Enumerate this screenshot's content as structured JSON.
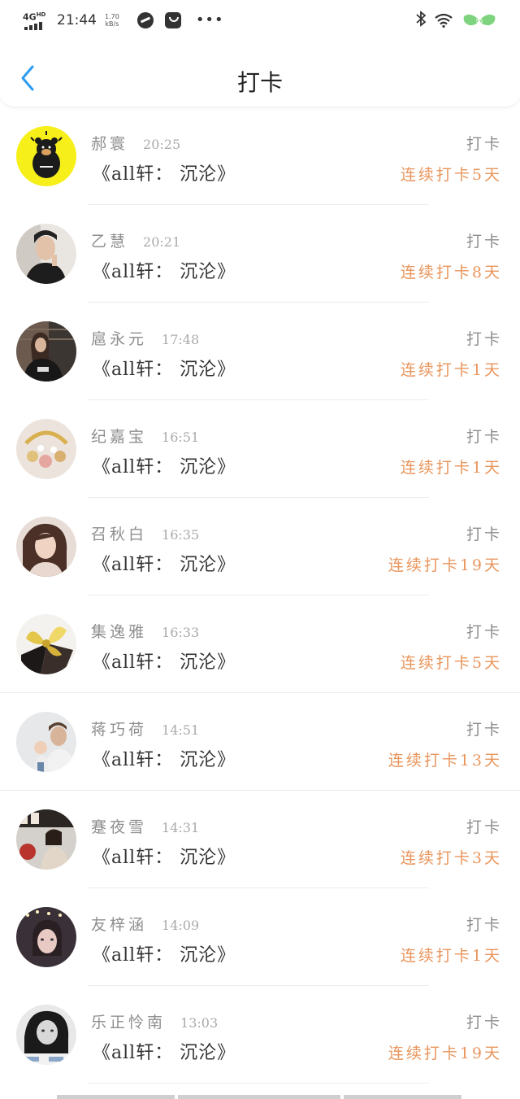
{
  "status_bar": {
    "network": "4G",
    "network_sup": "HD",
    "time": "21:44",
    "speed_value": "1.70",
    "speed_unit": "kB/s",
    "battery_level": "95"
  },
  "header": {
    "title": "打卡"
  },
  "colors": {
    "accent_back": "#2c9cf0",
    "streak": "#e9955c",
    "name": "#8e8e8e"
  },
  "entries": [
    {
      "name": "郝寰",
      "time": "20:25",
      "book": "《all轩： 沉沦》",
      "action": "打卡",
      "streak": "连续打卡5天",
      "avatar": "yellow-bear"
    },
    {
      "name": "乙慧",
      "time": "20:21",
      "book": "《all轩： 沉沦》",
      "action": "打卡",
      "streak": "连续打卡8天",
      "avatar": "man-portrait"
    },
    {
      "name": "扈永元",
      "time": "17:48",
      "book": "《all轩： 沉沦》",
      "action": "打卡",
      "streak": "连续打卡1天",
      "avatar": "woman-dark"
    },
    {
      "name": "纪嘉宝",
      "time": "16:51",
      "book": "《all轩： 沉沦》",
      "action": "打卡",
      "streak": "连续打卡1天",
      "avatar": "jewelry"
    },
    {
      "name": "召秋白",
      "time": "16:35",
      "book": "《all轩： 沉沦》",
      "action": "打卡",
      "streak": "连续打卡19天",
      "avatar": "woman-light"
    },
    {
      "name": "集逸雅",
      "time": "16:33",
      "book": "《all轩： 沉沦》",
      "action": "打卡",
      "streak": "连续打卡5天",
      "avatar": "gold-bow"
    },
    {
      "name": "蒋巧荷",
      "time": "14:51",
      "book": "《all轩： 沉沦》",
      "action": "打卡",
      "streak": "连续打卡13天",
      "avatar": "man-baby"
    },
    {
      "name": "蹇夜雪",
      "time": "14:31",
      "book": "《all轩： 沉沦》",
      "action": "打卡",
      "streak": "连续打卡3天",
      "avatar": "street"
    },
    {
      "name": "友梓涵",
      "time": "14:09",
      "book": "《all轩： 沉沦》",
      "action": "打卡",
      "streak": "连续打卡1天",
      "avatar": "girl-lights"
    },
    {
      "name": "乐正怜南",
      "time": "13:03",
      "book": "《all轩： 沉沦》",
      "action": "打卡",
      "streak": "连续打卡19天",
      "avatar": "bw-girl"
    }
  ]
}
